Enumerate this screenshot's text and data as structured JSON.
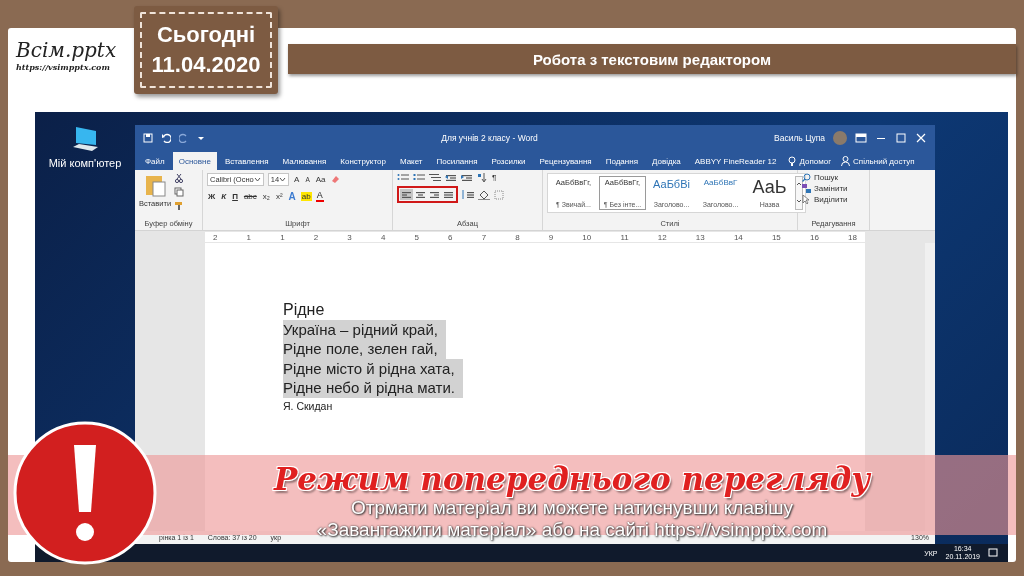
{
  "slide": {
    "logo": {
      "name": "Всім.pptx",
      "url": "https://vsimpptx.com"
    },
    "date_tag": {
      "label": "Сьогодні",
      "date": "11.04.2020"
    },
    "title": "Робота з текстовим редактором"
  },
  "desktop": {
    "icon_label": "Мій комп'ютер"
  },
  "word": {
    "title": "Для учнів 2 класу  -  Word",
    "user": "Василь Цупа",
    "tabs": [
      {
        "label": "Файл",
        "selected": false
      },
      {
        "label": "Основне",
        "selected": true
      },
      {
        "label": "Вставлення",
        "selected": false
      },
      {
        "label": "Малювання",
        "selected": false
      },
      {
        "label": "Конструктор",
        "selected": false
      },
      {
        "label": "Макет",
        "selected": false
      },
      {
        "label": "Посилання",
        "selected": false
      },
      {
        "label": "Розсилки",
        "selected": false
      },
      {
        "label": "Рецензування",
        "selected": false
      },
      {
        "label": "Подання",
        "selected": false
      },
      {
        "label": "Довідка",
        "selected": false
      },
      {
        "label": "ABBYY FineReader 12",
        "selected": false
      }
    ],
    "help": "Допомог",
    "share": "Спільний доступ",
    "ribbon": {
      "paste": "Вставити",
      "font_name": "Calibri (Осно",
      "font_size": "14",
      "grow_font": "A",
      "shrink_font": "A",
      "change_case": "Aa",
      "bold": "Ж",
      "italic": "К",
      "underline": "П",
      "strike": "abc",
      "subscript": "x₂",
      "superscript": "x²",
      "text_effects": "A",
      "highlight": "ab",
      "font_color": "A",
      "pilcrow": "¶",
      "align": [
        {
          "selected": true
        },
        {
          "selected": false
        },
        {
          "selected": false
        },
        {
          "selected": false
        }
      ],
      "styles": [
        {
          "kind": "normal",
          "sample": "АаБбВвГг,",
          "name": "¶ Звичай...",
          "selected": false
        },
        {
          "kind": "normal",
          "sample": "АаБбВвГг,",
          "name": "¶ Без інте...",
          "selected": true
        },
        {
          "kind": "heading1",
          "sample": "АаБбВі",
          "name": "Заголово...",
          "selected": false
        },
        {
          "kind": "heading2",
          "sample": "АаБбВвГ",
          "name": "Заголово...",
          "selected": false
        },
        {
          "kind": "title",
          "sample": "АаЬ",
          "name": "Назва",
          "selected": false
        }
      ],
      "find": "Пошук",
      "replace": "Замінити",
      "select": "Виділити",
      "groups": [
        "Буфер обміну",
        "Шрифт",
        "Абзац",
        "Стилі",
        "Редагування"
      ]
    },
    "ruler": [
      "2",
      "1",
      "1",
      "2",
      "3",
      "4",
      "5",
      "6",
      "7",
      "8",
      "9",
      "10",
      "11",
      "12",
      "13",
      "14",
      "15",
      "16",
      "18"
    ],
    "document": {
      "title": "Рідне",
      "lines": [
        {
          "text": "Україна – рідний край,",
          "highlighted": true
        },
        {
          "text": "Рідне поле, зелен гай,",
          "highlighted": true
        },
        {
          "text": "Рідне місто й рідна хата,",
          "highlighted": true
        },
        {
          "text": "Рідне небо й рідна мати.",
          "highlighted": true
        }
      ],
      "author": "Я. Скидан"
    },
    "status_bar": {
      "page": "рінка 1 із 1",
      "words": "Слова: 37 із 20",
      "language": "укр",
      "zoom": "130%"
    }
  },
  "taskbar": {
    "time": "16:34",
    "date": "20.11.2019",
    "language": "УКР"
  },
  "preview_banner": {
    "title": "Режим попереднього перегляду",
    "lines": [
      "Отрмати матеріал ви можете натиснувши клавішу",
      "«Завантажити матеріал» або на сайті https://vsimpptx.com"
    ]
  }
}
